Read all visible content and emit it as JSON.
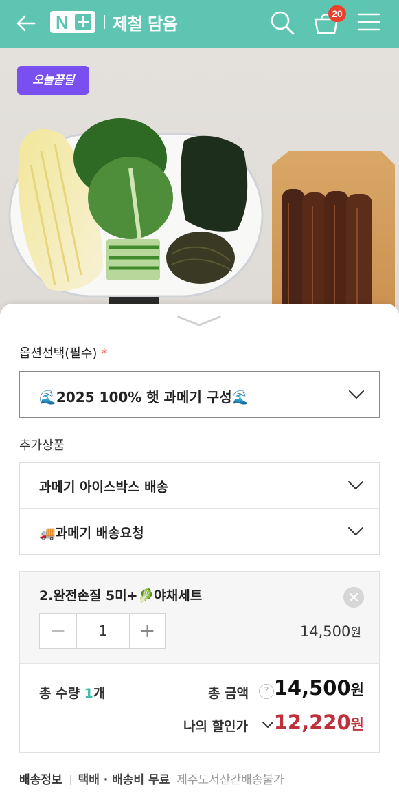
{
  "header": {
    "logo_n": "N",
    "store_name": "제철 담음",
    "cart_count": "20",
    "bg_color": "#5fc5b3"
  },
  "hero": {
    "badge": "오늘끝딜"
  },
  "options": {
    "label": "옵션선택(필수)",
    "required_mark": "*",
    "selected_value": "🌊2025 100% 햇 과메기 구성🌊"
  },
  "addons": {
    "label": "추가상품",
    "items": [
      {
        "label": "과메기 아이스박스 배송"
      },
      {
        "label": "🚚과메기 배송요청"
      }
    ]
  },
  "selected_item": {
    "name": "2.완전손질 5미+🥬야채세트",
    "quantity": "1",
    "price": "14,500",
    "currency": "원"
  },
  "totals": {
    "qty_label_prefix": "총 수량 ",
    "qty_value": "1",
    "qty_unit": "개",
    "amount_label": "총 금액",
    "amount_value": "14,500",
    "discount_label": "나의 할인가",
    "discount_value": "12,220",
    "currency": "원",
    "discount_color": "#c0303a"
  },
  "shipping": {
    "label": "배송정보",
    "method": "택배 · 배송비 무료",
    "note": "제주도서산간배송불가"
  }
}
